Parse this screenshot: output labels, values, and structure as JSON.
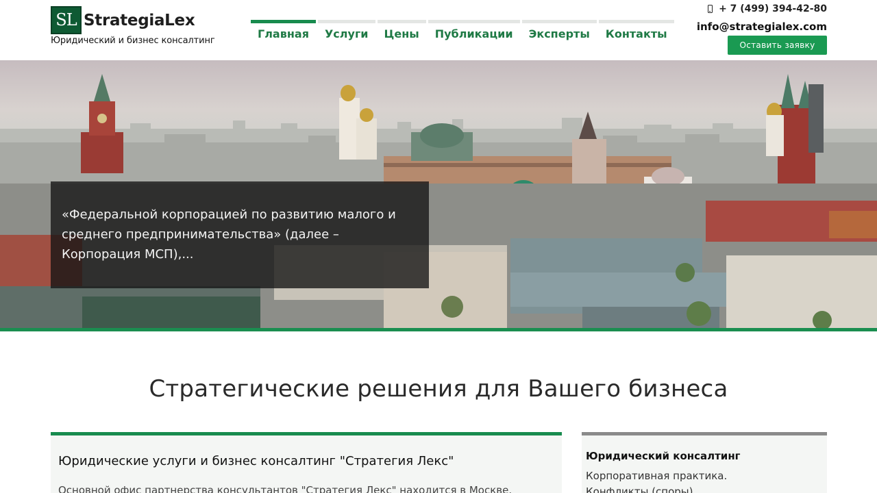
{
  "header": {
    "logo_mark": "SL",
    "logo_name": "StrategiaLex",
    "tagline": "Юридический и бизнес консалтинг",
    "phone": "+ 7 (499) 394-42-80",
    "email": "info@strategialex.com",
    "cta_label": "Оставить заявку"
  },
  "nav": {
    "items": [
      {
        "label": "Главная",
        "active": true
      },
      {
        "label": "Услуги"
      },
      {
        "label": "Цены"
      },
      {
        "label": "Публикации"
      },
      {
        "label": "Эксперты"
      },
      {
        "label": "Контакты"
      }
    ]
  },
  "hero": {
    "quote": "«Федеральной корпорацией по развитию малого и среднего предпринимательства» (далее – Корпорация МСП),..."
  },
  "main": {
    "title": "Стратегические решения для Вашего бизнеса",
    "card_left": {
      "title": "Юридические услуги и бизнес консалтинг \"Стратегия Лекс\"",
      "text": "Основной офис партнерства консультантов \"Стратегия Лекс\" находится в Москве."
    },
    "card_right": {
      "title": "Юридический консалтинг",
      "items": [
        "Корпоративная практика.",
        "Конфликты (споры)."
      ]
    }
  },
  "colors": {
    "brand_green": "#1a9a52",
    "nav_text": "#1f7a45",
    "logo_dark": "#0e5a33"
  }
}
